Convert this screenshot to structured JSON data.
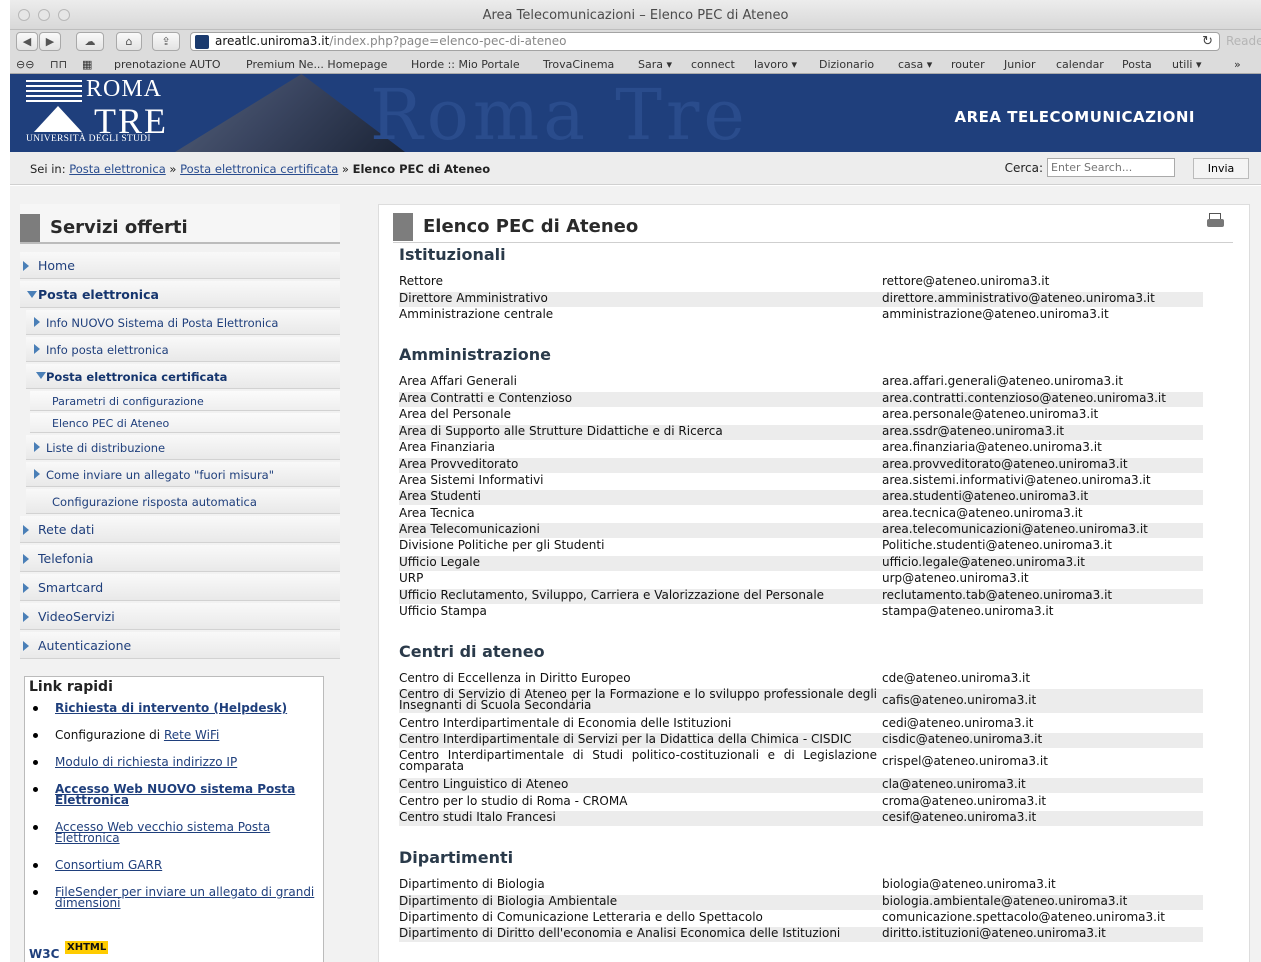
{
  "browser": {
    "window_title": "Area Telecomunicazioni – Elenco PEC di Ateneo",
    "url_domain": "areatlc.uniroma3.it",
    "url_path": "/index.php?page=elenco-pec-di-ateneo",
    "reader_label": "Reader",
    "bookmarks": [
      "prenotazione AUTO",
      "Premium Ne... Homepage",
      "Horde :: Mio Portale",
      "TrovaCinema",
      "Sara ▾",
      "connect",
      "lavoro ▾",
      "Dizionario",
      "casa ▾",
      "router",
      "Junior",
      "calendar",
      "Posta",
      "utili ▾"
    ]
  },
  "banner": {
    "logo_line1": "ROMA",
    "logo_line2": "TRE",
    "logo_line3": "UNIVERSITÀ DEGLI STUDI",
    "area_title": "AREA TELECOMUNICAZIONI"
  },
  "breadcrumb": {
    "prefix": "Sei in:",
    "items": [
      "Posta elettronica",
      "Posta elettronica certificata"
    ],
    "current": "Elenco PEC di Ateneo"
  },
  "search": {
    "label": "Cerca:",
    "placeholder": "Enter Search...",
    "button": "Invia"
  },
  "sidebar": {
    "title": "Servizi offerti",
    "items": {
      "home": "Home",
      "posta": "Posta elettronica",
      "info_nuovo": "Info NUOVO Sistema di Posta Elettronica",
      "info_posta": "Info posta elettronica",
      "pec": "Posta elettronica certificata",
      "parametri": "Parametri di configurazione",
      "elenco": "Elenco PEC di Ateneo",
      "liste": "Liste di distribuzione",
      "allegato": "Come inviare un allegato \"fuori misura\"",
      "risposta": "Configurazione risposta automatica",
      "rete": "Rete dati",
      "telefonia": "Telefonia",
      "smartcard": "Smartcard",
      "video": "VideoServizi",
      "auth": "Autenticazione"
    }
  },
  "links": {
    "title": "Link rapidi",
    "helpdesk": "Richiesta di intervento (Helpdesk)",
    "wifi_prefix": "Configurazione di ",
    "wifi": "Rete WiFi",
    "ip": "Modulo di richiesta indirizzo IP",
    "nuovo": "Accesso Web NUOVO sistema Posta Elettronica",
    "vecchio": "Accesso Web vecchio sistema Posta Elettronica",
    "garr": "Consortium GARR",
    "filesender": "FileSender per inviare un allegato di grandi dimensioni",
    "badge_w3c": "W3C",
    "badge_xhtml": "XHTML"
  },
  "main": {
    "title": "Elenco PEC di Ateneo",
    "sections": {
      "ist": {
        "title": "Istituzionali",
        "rows": [
          [
            "Rettore",
            "rettore@ateneo.uniroma3.it"
          ],
          [
            "Direttore Amministrativo",
            "direttore.amministrativo@ateneo.uniroma3.it"
          ],
          [
            "Amministrazione centrale",
            "amministrazione@ateneo.uniroma3.it"
          ]
        ]
      },
      "amm": {
        "title": "Amministrazione",
        "rows": [
          [
            "Area Affari Generali",
            "area.affari.generali@ateneo.uniroma3.it"
          ],
          [
            "Area Contratti e Contenzioso",
            "area.contratti.contenzioso@ateneo.uniroma3.it"
          ],
          [
            "Area del Personale",
            "area.personale@ateneo.uniroma3.it"
          ],
          [
            "Area di Supporto alle Strutture Didattiche e di Ricerca",
            "area.ssdr@ateneo.uniroma3.it"
          ],
          [
            "Area Finanziaria",
            "area.finanziaria@ateneo.uniroma3.it"
          ],
          [
            "Area Provveditorato",
            "area.provveditorato@ateneo.uniroma3.it"
          ],
          [
            "Area Sistemi Informativi",
            "area.sistemi.informativi@ateneo.uniroma3.it"
          ],
          [
            "Area Studenti",
            "area.studenti@ateneo.uniroma3.it"
          ],
          [
            "Area Tecnica",
            "area.tecnica@ateneo.uniroma3.it"
          ],
          [
            "Area Telecomunicazioni",
            "area.telecomunicazioni@ateneo.uniroma3.it"
          ],
          [
            "Divisione Politiche per gli Studenti",
            "Politiche.studenti@ateneo.uniroma3.it"
          ],
          [
            "Ufficio Legale",
            "ufficio.legale@ateneo.uniroma3.it"
          ],
          [
            "URP",
            "urp@ateneo.uniroma3.it"
          ],
          [
            "Ufficio Reclutamento, Sviluppo, Carriera e Valorizzazione del Personale",
            "reclutamento.tab@ateneo.uniroma3.it"
          ],
          [
            "Ufficio Stampa",
            "stampa@ateneo.uniroma3.it"
          ]
        ]
      },
      "cen": {
        "title": "Centri di ateneo",
        "rows": [
          [
            "Centro di Eccellenza in Diritto Europeo",
            "cde@ateneo.uniroma3.it"
          ],
          [
            "Centro di Servizio di Ateneo per la Formazione e lo sviluppo professionale degli Insegnanti di Scuola Secondaria",
            "cafis@ateneo.uniroma3.it"
          ],
          [
            "Centro Interdipartimentale di Economia delle Istituzioni",
            "cedi@ateneo.uniroma3.it"
          ],
          [
            "Centro Interdipartimentale di Servizi per la Didattica della Chimica - CISDIC",
            "cisdic@ateneo.uniroma3.it"
          ],
          [
            "Centro Interdipartimentale di Studi politico-costituzionali e di Legislazione comparata",
            "crispel@ateneo.uniroma3.it"
          ],
          [
            "Centro Linguistico di Ateneo",
            "cla@ateneo.uniroma3.it"
          ],
          [
            "Centro per lo studio di Roma - CROMA",
            "croma@ateneo.uniroma3.it"
          ],
          [
            "Centro studi Italo Francesi",
            "cesif@ateneo.uniroma3.it"
          ]
        ]
      },
      "dip": {
        "title": "Dipartimenti",
        "rows": [
          [
            "Dipartimento di Biologia",
            "biologia@ateneo.uniroma3.it"
          ],
          [
            "Dipartimento di Biologia Ambientale",
            "biologia.ambientale@ateneo.uniroma3.it"
          ],
          [
            "Dipartimento di Comunicazione Letteraria e dello Spettacolo",
            "comunicazione.spettacolo@ateneo.uniroma3.it"
          ],
          [
            "Dipartimento di Diritto dell'economia e Analisi Economica delle Istituzioni",
            "diritto.istituzioni@ateneo.uniroma3.it"
          ]
        ]
      }
    }
  }
}
